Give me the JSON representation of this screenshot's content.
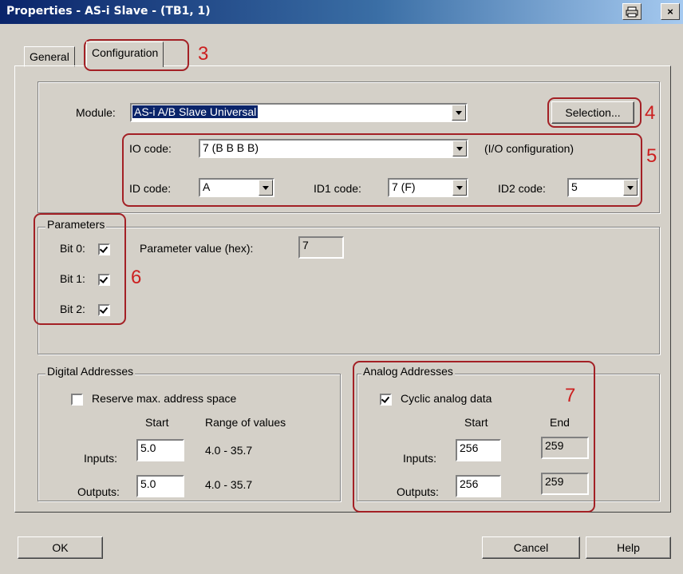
{
  "window": {
    "title": "Properties - AS-i Slave - (TB1, 1)",
    "print_icon": "printer-icon",
    "close_glyph": "×"
  },
  "tabs": [
    {
      "label": "General"
    },
    {
      "label": "Configuration"
    }
  ],
  "module": {
    "label": "Module:",
    "value": "AS-i A/B Slave Universal",
    "selection_button": "Selection..."
  },
  "codes": {
    "io_label": "IO code:",
    "io_value": "7  (B B B B)",
    "io_note": "(I/O configuration)",
    "id_label": "ID code:",
    "id_value": "A",
    "id1_label": "ID1 code:",
    "id1_value": "7  (F)",
    "id2_label": "ID2 code:",
    "id2_value": "5"
  },
  "parameters": {
    "legend": "Parameters",
    "bits": [
      {
        "label": "Bit 0:",
        "checked": true
      },
      {
        "label": "Bit 1:",
        "checked": true
      },
      {
        "label": "Bit 2:",
        "checked": true
      }
    ],
    "value_label": "Parameter value (hex):",
    "value": "7"
  },
  "digital": {
    "legend": "Digital Addresses",
    "reserve_label": "Reserve max. address space",
    "reserve_checked": false,
    "start_header": "Start",
    "range_header": "Range of values",
    "inputs_label": "Inputs:",
    "inputs_start": "5.0",
    "inputs_range": "4.0 - 35.7",
    "outputs_label": "Outputs:",
    "outputs_start": "5.0",
    "outputs_range": "4.0 - 35.7"
  },
  "analog": {
    "legend": "Analog Addresses",
    "cyclic_label": "Cyclic analog data",
    "cyclic_checked": true,
    "start_header": "Start",
    "end_header": "End",
    "inputs_label": "Inputs:",
    "inputs_start": "256",
    "inputs_end": "259",
    "outputs_label": "Outputs:",
    "outputs_start": "256",
    "outputs_end": "259"
  },
  "footer": {
    "ok": "OK",
    "cancel": "Cancel",
    "help": "Help"
  },
  "callouts": [
    "3",
    "4",
    "5",
    "6",
    "7"
  ],
  "colors": {
    "title_bar": "#0a246a",
    "callout": "#cc1f1f",
    "dialog": "#d4d0c8"
  }
}
